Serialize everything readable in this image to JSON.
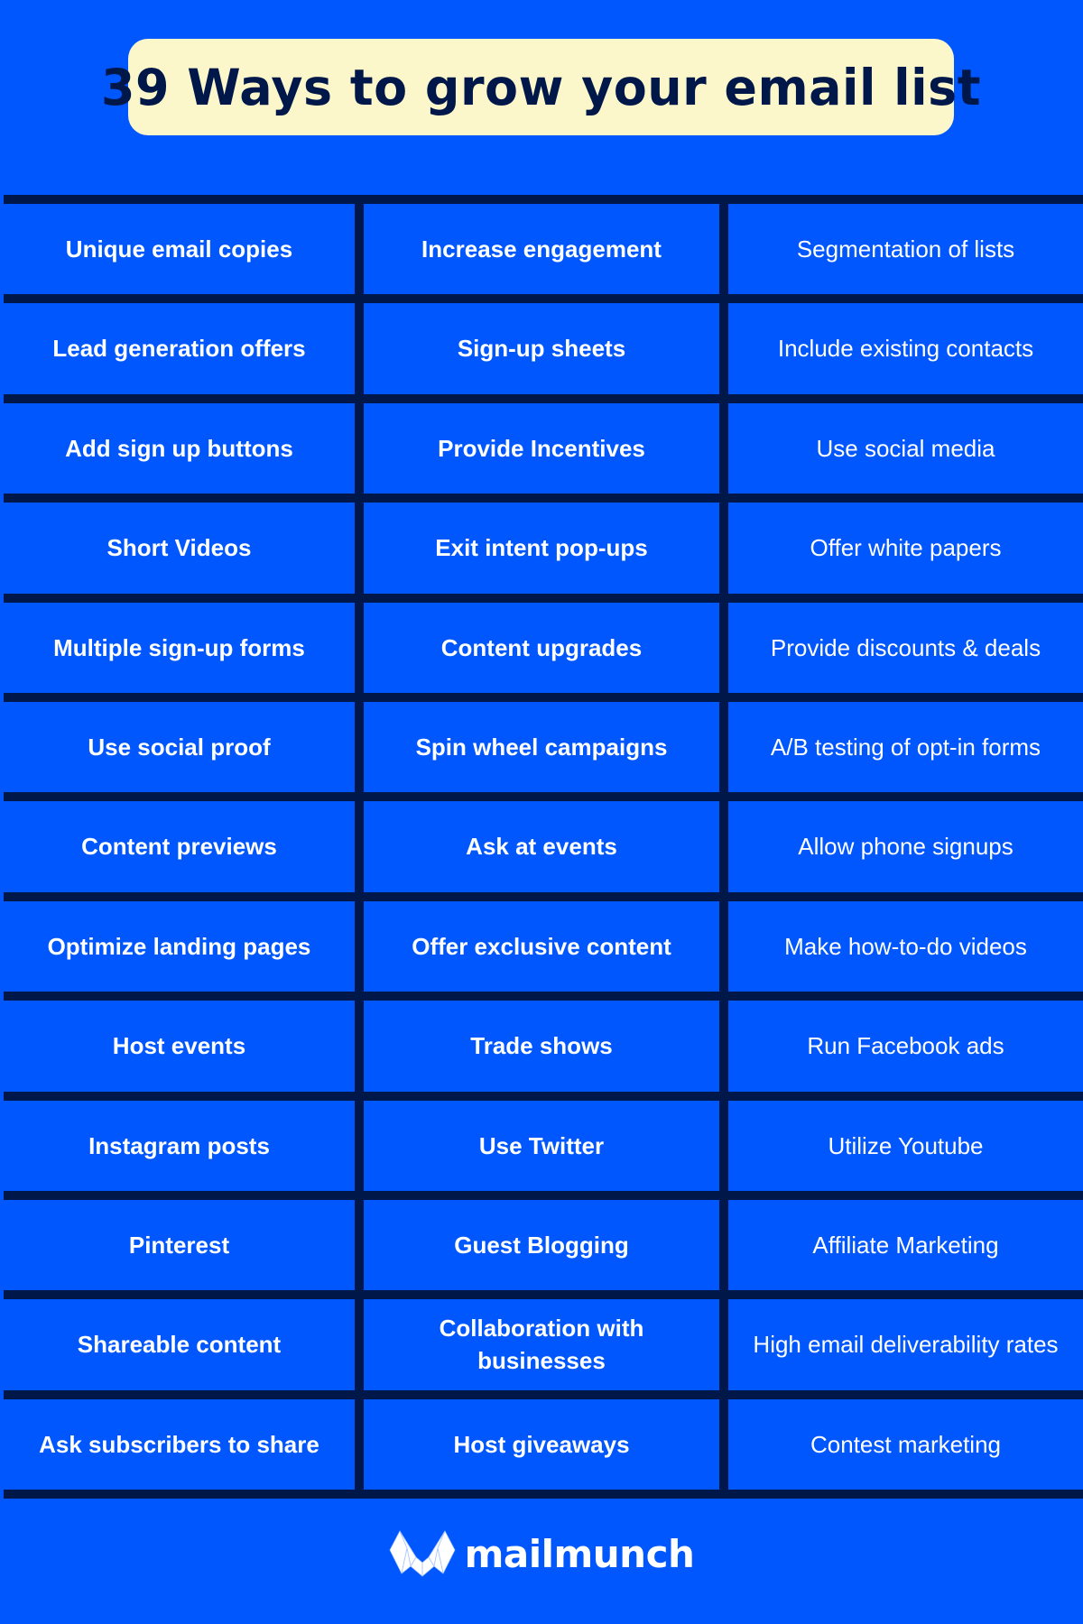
{
  "title": "39 Ways to grow your email list",
  "colors": {
    "background": "#0057fe",
    "grid_line": "#00174a",
    "title_bg": "#fcf7cb",
    "title_text": "#00174a",
    "cell_text": "#ffffff"
  },
  "rows": [
    [
      "Unique email copies",
      "Increase engagement",
      "Segmentation of lists"
    ],
    [
      "Lead generation offers",
      "Sign-up sheets",
      "Include existing contacts"
    ],
    [
      "Add sign up buttons",
      "Provide Incentives",
      "Use social media"
    ],
    [
      "Short Videos",
      "Exit intent pop-ups",
      "Offer white papers"
    ],
    [
      "Multiple sign-up forms",
      "Content upgrades",
      "Provide discounts & deals"
    ],
    [
      "Use social proof",
      "Spin wheel campaigns",
      "A/B testing of opt-in forms"
    ],
    [
      "Content previews",
      "Ask at events",
      "Allow phone signups"
    ],
    [
      "Optimize landing pages",
      "Offer exclusive content",
      "Make how-to-do videos"
    ],
    [
      "Host events",
      "Trade shows",
      "Run Facebook ads"
    ],
    [
      "Instagram posts",
      "Use Twitter",
      "Utilize Youtube"
    ],
    [
      "Pinterest",
      "Guest Blogging",
      "Affiliate Marketing"
    ],
    [
      "Shareable content",
      "Collaboration with businesses",
      "High email deliverability rates"
    ],
    [
      "Ask subscribers to share",
      "Host giveaways",
      "Contest marketing"
    ]
  ],
  "footer": {
    "logo_icon": "mailmunch-logo-icon",
    "brand": "mailmunch"
  }
}
